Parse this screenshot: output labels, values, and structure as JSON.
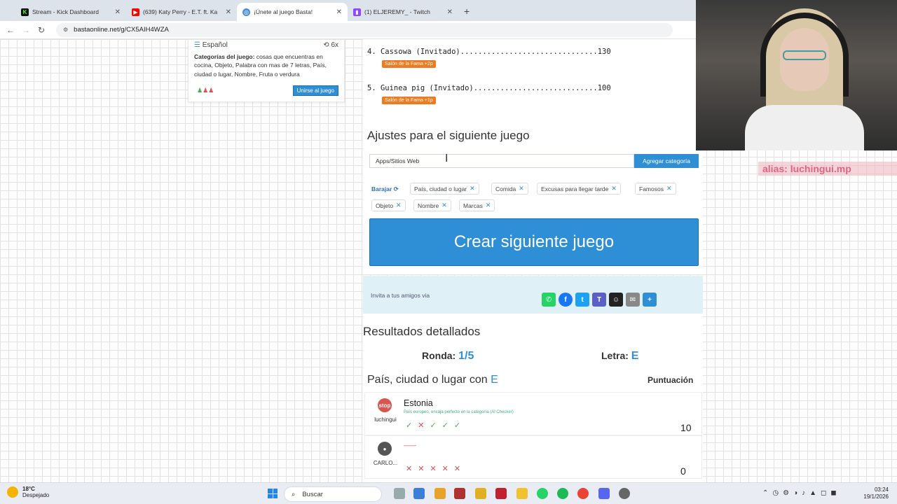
{
  "browser": {
    "tabs": [
      {
        "title": "Stream - Kick Dashboard",
        "color": "#53fc18"
      },
      {
        "title": "(639) Katy Perry - E.T. ft. Ka",
        "color": "#ff0000"
      },
      {
        "title": "¡Únete al juego Basta!",
        "color": "#4a90d9"
      },
      {
        "title": "(1) ELJEREMY_ - Twitch",
        "color": "#9146ff"
      }
    ],
    "url": "bastaonline.net/g/CX5AIH4WZA"
  },
  "game_card": {
    "language": "Español",
    "timer": "6x",
    "categories_label": "Categorías del juego:",
    "categories_text": "cosas que encuentras en cocina, Objeto, Palabra con mas de 7 letras, País, ciudad o lugar, Nombre, Fruta o verdura",
    "join_button": "Unirse al juego"
  },
  "scores": [
    {
      "line": "4. Cassowa (Invitado)...............................130",
      "badge": "Salón de la Fama +2p"
    },
    {
      "line": "5. Guinea pig (Invitado)............................100",
      "badge": "Salón de la Fama +1p"
    }
  ],
  "settings": {
    "title": "Ajustes para el siguiente juego",
    "input_value": "Apps/Sitios Web",
    "add_button": "Agregar categoría",
    "shuffle_label": "Barajar",
    "chips": [
      "País, ciudad o lugar",
      "Comida",
      "Excusas para llegar tarde",
      "Famosos",
      "Objeto",
      "Nombre",
      "Marcas"
    ],
    "create_button": "Crear siguiente juego"
  },
  "invite": {
    "text": "Invita a tus amigos via",
    "icons": [
      "whatsapp-icon",
      "facebook-icon",
      "twitter-icon",
      "teams-icon",
      "snapchat-icon",
      "email-icon",
      "share-icon"
    ]
  },
  "results": {
    "title": "Resultados detallados",
    "round_label": "Ronda:",
    "round_value": "1/5",
    "letter_label": "Letra:",
    "letter_value": "E",
    "category_prefix": "País, ciudad o lugar con",
    "category_letter": "E",
    "score_header": "Puntuación",
    "entries": [
      {
        "user": "luchingui",
        "answer": "Estonia",
        "note": "País europeo, encaja perfecto en la categoría (AI Checker)",
        "marks": [
          "ok",
          "no",
          "ok",
          "ok",
          "ok"
        ],
        "points": "10"
      },
      {
        "user": "CARLO...",
        "answer": "——",
        "note": "",
        "marks": [
          "no",
          "no",
          "no",
          "no",
          "no"
        ],
        "points": "0"
      }
    ]
  },
  "stream_overlay": {
    "text": "alias: luchingui.mp"
  },
  "taskbar": {
    "weather_temp": "18°C",
    "weather_text": "Despejado",
    "search_label": "Buscar",
    "time": "03:24",
    "date": "19/1/2026"
  }
}
